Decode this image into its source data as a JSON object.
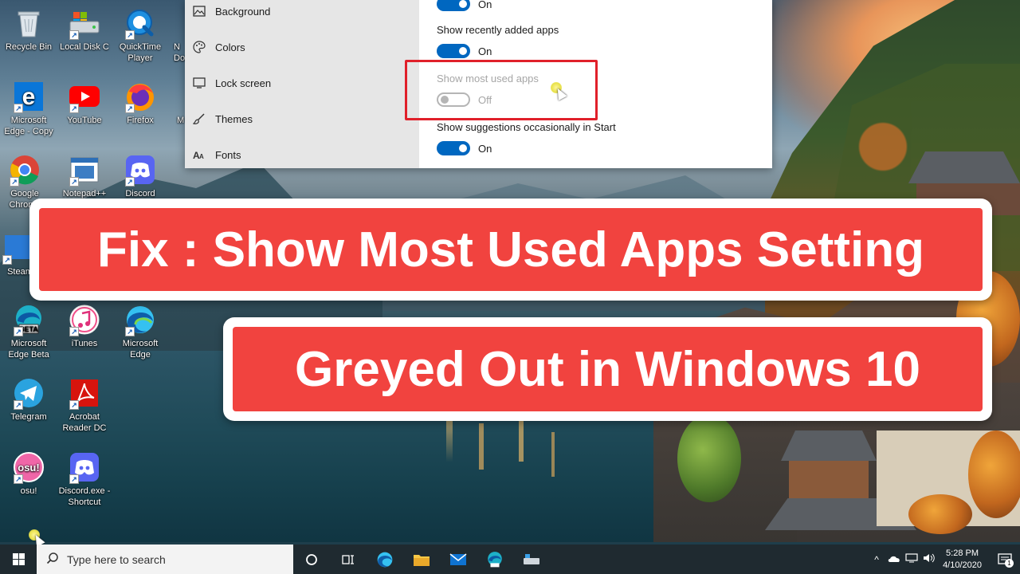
{
  "desktop_icons": [
    {
      "label": "Recycle Bin",
      "icon": "recycle-bin-icon"
    },
    {
      "label": "Local Disk C",
      "icon": "local-disk-icon"
    },
    {
      "label": "QuickTime Player",
      "icon": "quicktime-icon"
    },
    {
      "label": "N Doc",
      "icon": "document-icon"
    },
    {
      "label": "Microsoft Edge - Copy",
      "icon": "edge-legacy-icon"
    },
    {
      "label": "YouTube",
      "icon": "youtube-icon"
    },
    {
      "label": "Firefox",
      "icon": "firefox-icon"
    },
    {
      "label": "M",
      "icon": "app-icon"
    },
    {
      "label": "Google Chrome",
      "icon": "chrome-icon"
    },
    {
      "label": "Notepad++",
      "icon": "notepad-icon"
    },
    {
      "label": "Discord",
      "icon": "discord-icon"
    },
    {
      "label": "Steam",
      "icon": "steam-icon"
    },
    {
      "label": "Microsoft Edge Beta",
      "icon": "edge-beta-icon"
    },
    {
      "label": "iTunes",
      "icon": "itunes-icon"
    },
    {
      "label": "Microsoft Edge",
      "icon": "edge-icon"
    },
    {
      "label": "Telegram",
      "icon": "telegram-icon"
    },
    {
      "label": "Acrobat Reader DC",
      "icon": "acrobat-icon"
    },
    {
      "label": "osu!",
      "icon": "osu-icon"
    },
    {
      "label": "Discord.exe - Shortcut",
      "icon": "discord-icon"
    }
  ],
  "settings": {
    "nav": [
      {
        "label": "Background",
        "icon": "picture-icon"
      },
      {
        "label": "Colors",
        "icon": "palette-icon"
      },
      {
        "label": "Lock screen",
        "icon": "lock-screen-icon"
      },
      {
        "label": "Themes",
        "icon": "brush-icon"
      },
      {
        "label": "Fonts",
        "icon": "font-icon"
      }
    ],
    "top_toggle_text": "On",
    "options": [
      {
        "label": "Show recently added apps",
        "state": "On",
        "enabled": true
      },
      {
        "label": "Show most used apps",
        "state": "Off",
        "enabled": false
      },
      {
        "label": "Show suggestions occasionally in Start",
        "state": "On",
        "enabled": true
      }
    ]
  },
  "banner": {
    "line1": "Fix : Show Most Used Apps Setting",
    "line2": "Greyed Out in Windows 10",
    "bg_color": "#f1433f"
  },
  "taskbar": {
    "search_placeholder": "Type here to search",
    "time": "5:28 PM",
    "date": "4/10/2020",
    "notification_count": "1"
  },
  "colors": {
    "accent": "#0067c0",
    "highlight": "#e0202a"
  }
}
